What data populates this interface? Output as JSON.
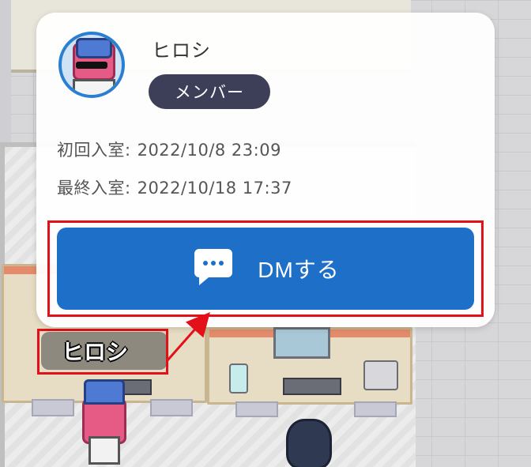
{
  "popup": {
    "user_name": "ヒロシ",
    "role_badge": "メンバー",
    "first_entry_label": "初回入室:",
    "first_entry_value": "2022/10/8 23:09",
    "last_entry_label": "最終入室:",
    "last_entry_value": "2022/10/18 17:37",
    "dm_button_label": "DMする",
    "dm_icon": "chat-bubble-icon"
  },
  "avatar": {
    "name_tag": "ヒロシ"
  },
  "colors": {
    "dm_button": "#1d6fc8",
    "badge_bg": "#3c3f57",
    "highlight_red": "#e3101a",
    "avatar_ring": "#2a7fd0"
  }
}
